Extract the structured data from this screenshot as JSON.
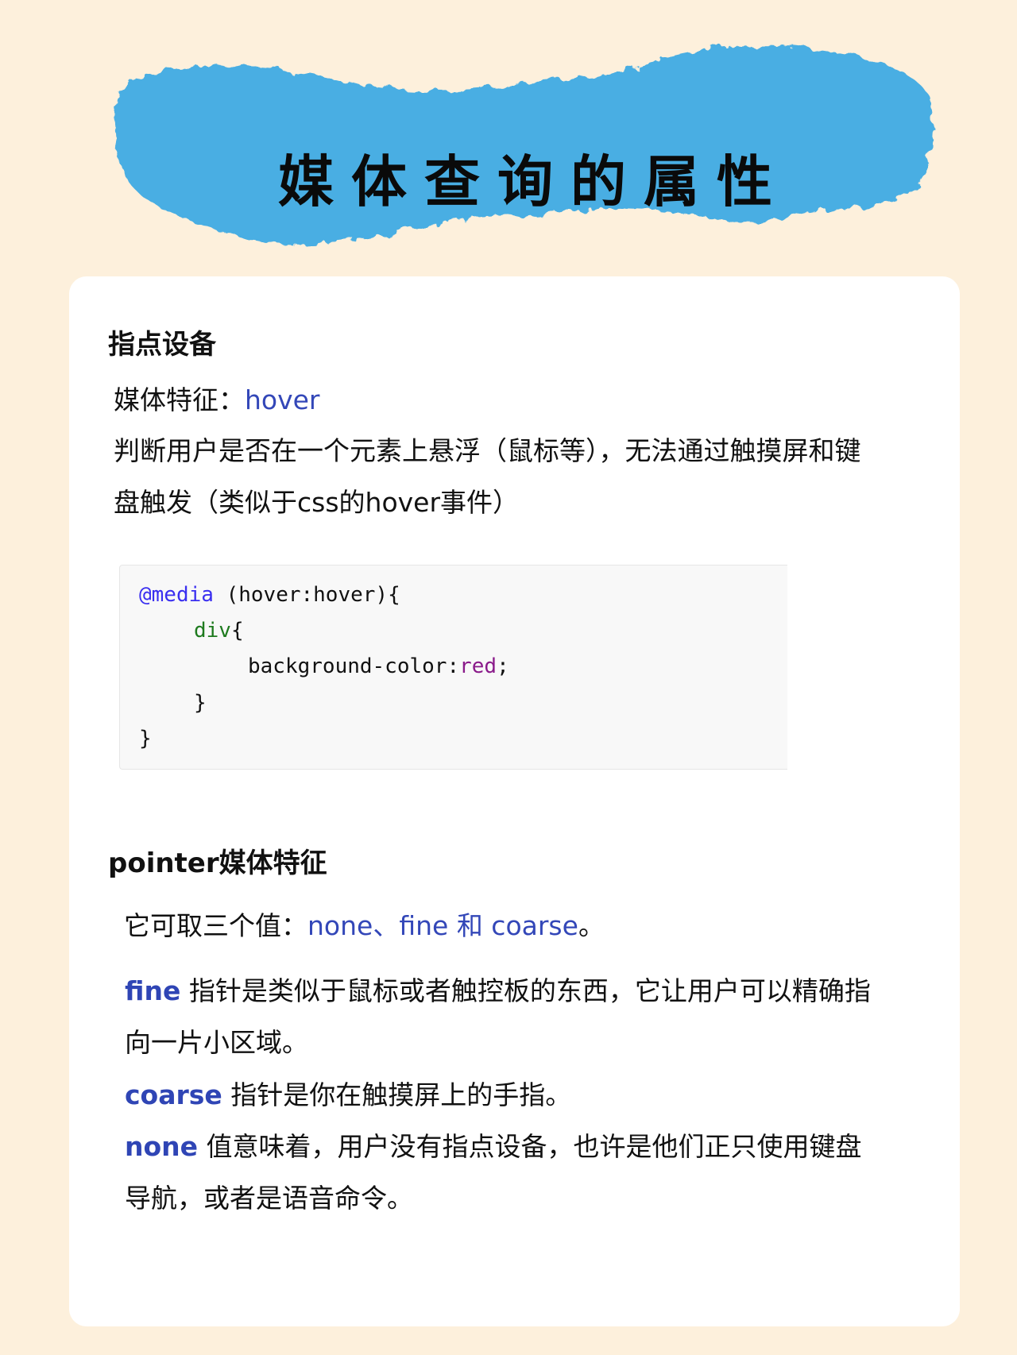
{
  "title": "媒体查询的属性",
  "section1": {
    "heading": "指点设备",
    "feature_label": "媒体特征：",
    "feature_value": "hover",
    "desc_line1": "判断用户是否在一个元素上悬浮（鼠标等），无法通过触摸屏和键",
    "desc_line2": "盘触发（类似于css的hover事件）",
    "code": {
      "at": "@media",
      "line1_rest": " (hover:hover){",
      "selector": "div",
      "brace_open": "{",
      "prop": "background-color:",
      "value": "red",
      "semi": ";",
      "close_inner": "}",
      "close_outer": "}"
    }
  },
  "section2": {
    "heading": "pointer媒体特征",
    "values_label": "它可取三个值：",
    "values": "none、fine 和 coarse",
    "values_end": "。",
    "fine_term": "fine",
    "fine_line1": " 指针是类似于鼠标或者触控板的东西，它让用户可以精确指",
    "fine_line2": "向一片小区域。",
    "coarse_term": "coarse",
    "coarse_desc": " 指针是你在触摸屏上的手指。",
    "none_term": "none",
    "none_line1": " 值意味着，用户没有指点设备，也许是他们正只使用键盘",
    "none_line2": "导航，或者是语音命令。"
  },
  "colors": {
    "background": "#fdf0dc",
    "banner": "#4aaee3",
    "accent": "#3347b8"
  }
}
